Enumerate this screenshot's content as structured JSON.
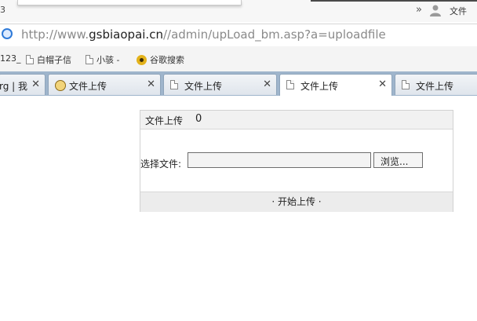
{
  "window": {
    "title_fragment": "3",
    "chevron": "»",
    "user_label": "文件"
  },
  "address": {
    "url_prefix": "http://www.",
    "url_host": "gsbiaopai.cn",
    "url_path": "//admin/upLoad_bm.asp?a=uploadfile"
  },
  "bookmarks": [
    {
      "label": "123_"
    },
    {
      "label": "白帽子信"
    },
    {
      "label": "小骇 -"
    },
    {
      "label": "谷歌搜索"
    }
  ],
  "tabs": [
    {
      "label": "rg | 我",
      "close": "✕"
    },
    {
      "label": "文件上传",
      "close": "✕"
    },
    {
      "label": "文件上传",
      "close": "✕"
    },
    {
      "label": "文件上传",
      "close": "✕"
    },
    {
      "label": "文件上传"
    }
  ],
  "upload": {
    "header_title": "文件上传",
    "header_count": "0",
    "field_label": "选择文件:",
    "browse_label": "浏览...",
    "start_label": "· 开始上传 ·"
  }
}
